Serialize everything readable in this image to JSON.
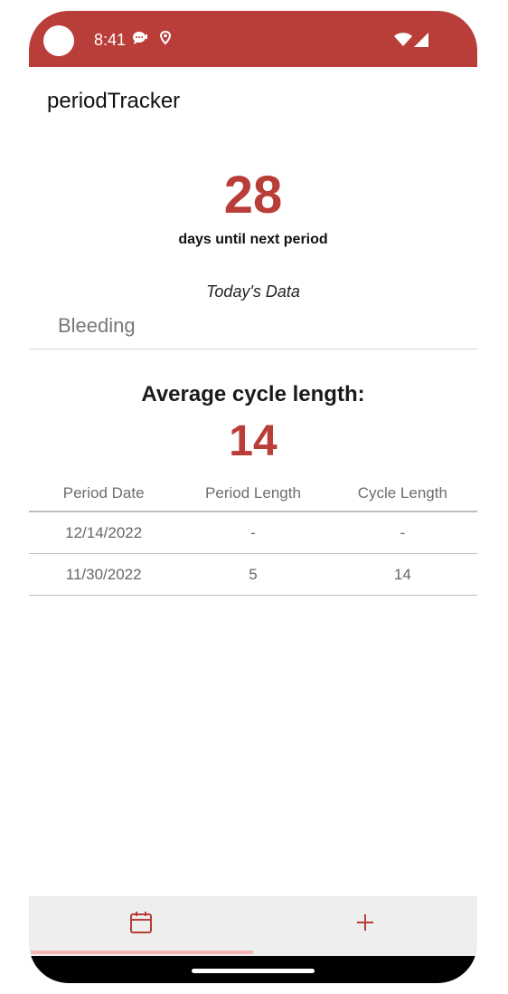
{
  "status_bar": {
    "time": "8:41",
    "icons": [
      "chat-bubble-icon",
      "location-pin-icon",
      "wifi-icon",
      "signal-icon"
    ],
    "color": "#b93d38"
  },
  "app": {
    "title": "periodTracker"
  },
  "countdown": {
    "days": "28",
    "label": "days until next period"
  },
  "today": {
    "heading": "Today's Data",
    "bleeding_placeholder": "Bleeding"
  },
  "average": {
    "label": "Average cycle length:",
    "value": "14"
  },
  "table": {
    "headers": [
      "Period Date",
      "Period Length",
      "Cycle Length"
    ],
    "rows": [
      [
        "12/14/2022",
        "-",
        "-"
      ],
      [
        "11/30/2022",
        "5",
        "14"
      ]
    ]
  },
  "bottom_nav": {
    "items": [
      "calendar-icon",
      "plus-icon"
    ],
    "active_index": 0
  },
  "colors": {
    "accent": "#b93d38",
    "indicator": "#f3b5b5"
  }
}
